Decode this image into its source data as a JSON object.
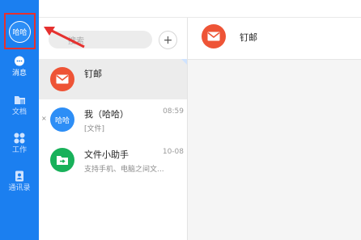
{
  "nav": {
    "avatar_label": "哈哈",
    "items": [
      {
        "label": "消息",
        "icon": "chat-bubble-icon"
      },
      {
        "label": "文档",
        "icon": "folder-icon"
      },
      {
        "label": "工作",
        "icon": "grid-icon"
      },
      {
        "label": "通讯录",
        "icon": "contacts-icon"
      }
    ]
  },
  "list": {
    "search_placeholder": "搜索",
    "add_label": "+",
    "items": [
      {
        "name": "钉邮",
        "time": "",
        "sub": "",
        "avatar": "mail-icon",
        "color": "#ee5436"
      },
      {
        "name": "我（哈哈）",
        "time": "08:59",
        "sub": "[文件]",
        "avatar_text": "哈哈",
        "color": "#2d8ef6"
      },
      {
        "name": "文件小助手",
        "time": "10-08",
        "sub": "支持手机、电脑之间文...",
        "avatar": "file-transfer-icon",
        "color": "#18b15a"
      }
    ]
  },
  "chat": {
    "title": "钉邮"
  },
  "colors": {
    "nav_bg": "#1b7ff0",
    "highlight_red": "#e5312f"
  }
}
